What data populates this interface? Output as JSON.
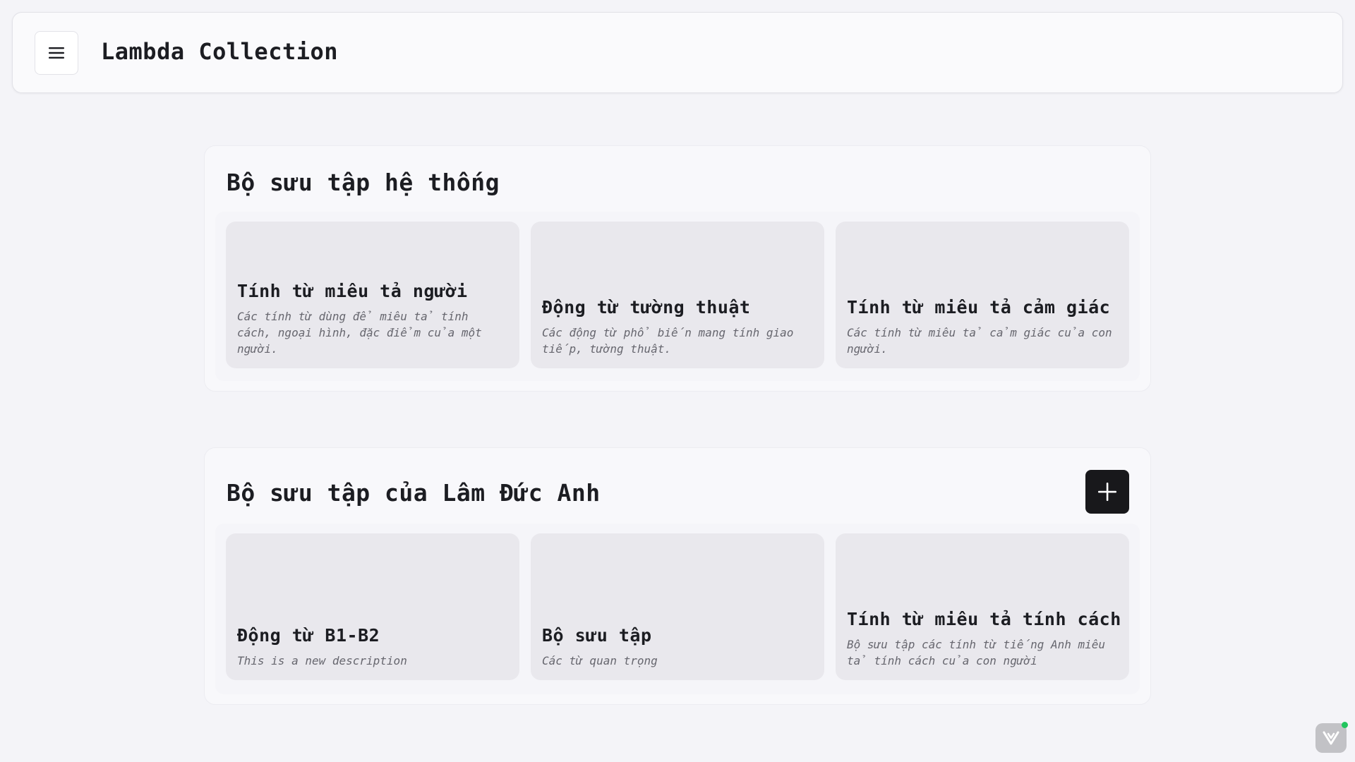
{
  "header": {
    "title": "Lambda Collection",
    "menu_icon": "hamburger-menu-icon"
  },
  "system_section": {
    "title": "Bộ sưu tập hệ thống",
    "cards": [
      {
        "title": "Tính từ miêu tả người",
        "description": "Các tính từ dùng để miêu tả tính cách, ngoại hình, đặc điểm của một người."
      },
      {
        "title": "Động từ tường thuật",
        "description": "Các động từ phổ biến mang tính giao tiếp, tường thuật."
      },
      {
        "title": "Tính từ miêu tả cảm giác",
        "description": "Các tính từ miêu tả cảm giác của con người."
      }
    ]
  },
  "user_section": {
    "title": "Bộ sưu tập của Lâm Đức Anh",
    "add_icon": "plus-icon",
    "cards": [
      {
        "title": "Động từ B1-B2",
        "description": "This is a new description"
      },
      {
        "title": "Bộ sưu tập",
        "description": "Các từ quan trọng"
      },
      {
        "title": "Tính từ miêu tả tính cách",
        "description": "Bộ sưu tập các tính từ tiếng Anh miêu tả tính cách của con người"
      }
    ]
  },
  "colors": {
    "background": "#f4f4f8",
    "card": "#e9e8ed",
    "primary_button": "#18181b",
    "status_dot": "#22c55e"
  }
}
